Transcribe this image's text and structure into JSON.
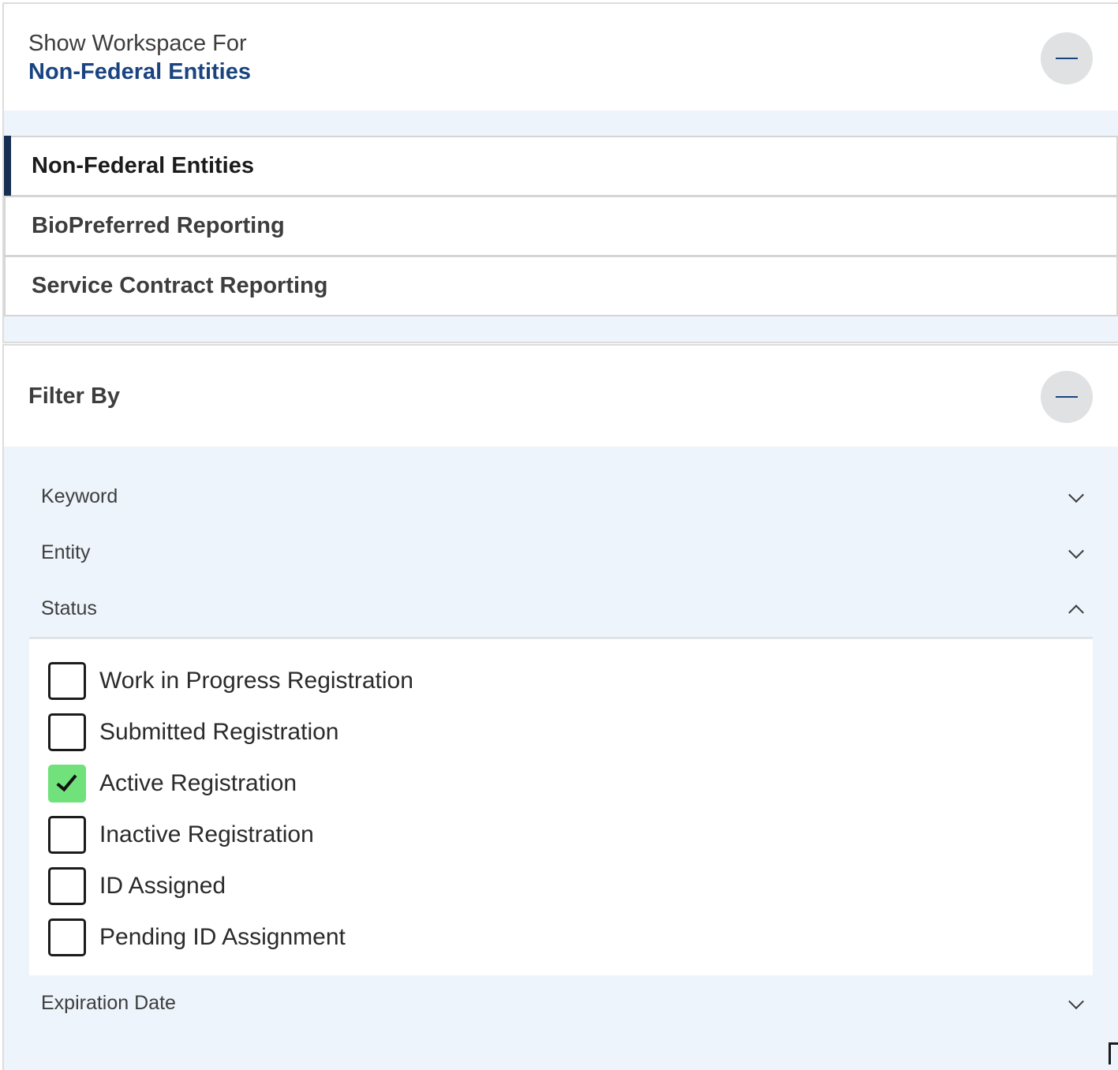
{
  "workspace": {
    "kicker": "Show Workspace For",
    "selected": "Non-Federal Entities",
    "items": [
      {
        "label": "Non-Federal Entities",
        "active": true
      },
      {
        "label": "BioPreferred Reporting",
        "active": false
      },
      {
        "label": "Service Contract Reporting",
        "active": false
      }
    ]
  },
  "filter": {
    "title": "Filter By",
    "sections": {
      "keyword": "Keyword",
      "entity": "Entity",
      "status": "Status",
      "expiration": "Expiration Date"
    },
    "status_options": [
      {
        "label": "Work in Progress Registration",
        "checked": false
      },
      {
        "label": "Submitted Registration",
        "checked": false
      },
      {
        "label": "Active Registration",
        "checked": true
      },
      {
        "label": "Inactive Registration",
        "checked": false
      },
      {
        "label": "ID Assigned",
        "checked": false
      },
      {
        "label": "Pending ID Assignment",
        "checked": false
      }
    ]
  },
  "colors": {
    "accent": "#1a4480",
    "active_bar": "#162e51",
    "panel_bg": "#edf4fb",
    "checked": "#70e17b"
  },
  "icons": [
    "minus-icon",
    "chevron-down-icon",
    "chevron-up-icon",
    "check-icon"
  ]
}
